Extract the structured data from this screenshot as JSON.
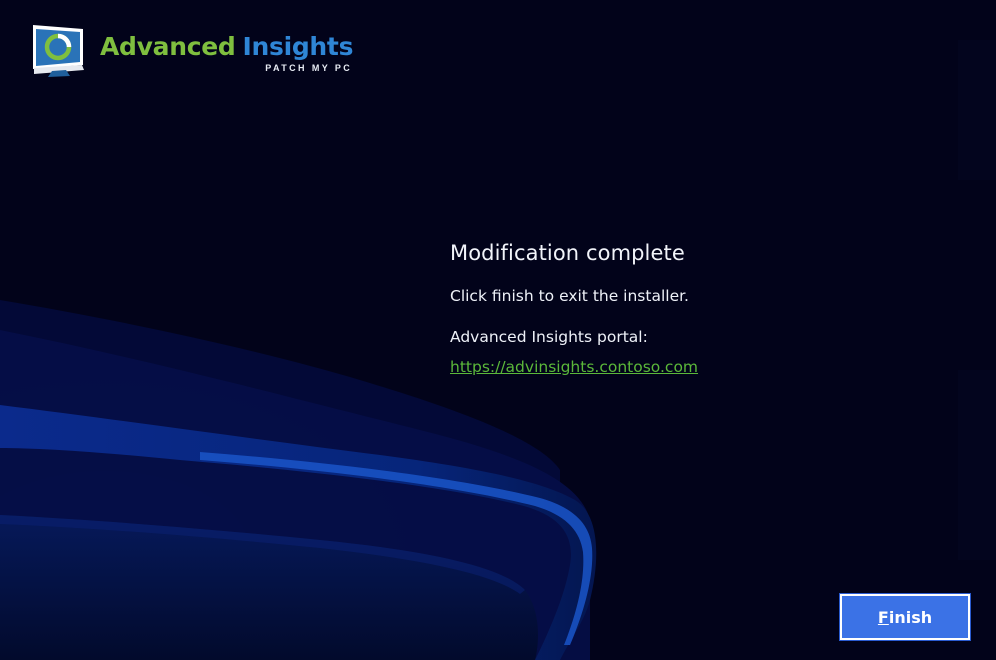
{
  "logo": {
    "brand_primary": "Advanced",
    "brand_secondary": "Insights",
    "subtitle": "PATCH MY PC",
    "icon": "monitor-logo-icon"
  },
  "completion": {
    "heading": "Modification complete",
    "message": "Click finish to exit the installer.",
    "portal_label": "Advanced Insights portal:",
    "portal_url": "https://advinsights.contoso.com"
  },
  "actions": {
    "finish_mnemonic": "F",
    "finish_rest": "inish"
  },
  "colors": {
    "background": "#02031a",
    "brand_green": "#7fbf3f",
    "brand_blue": "#2f86d6",
    "link": "#5bb83a",
    "button": "#3b72e6"
  }
}
